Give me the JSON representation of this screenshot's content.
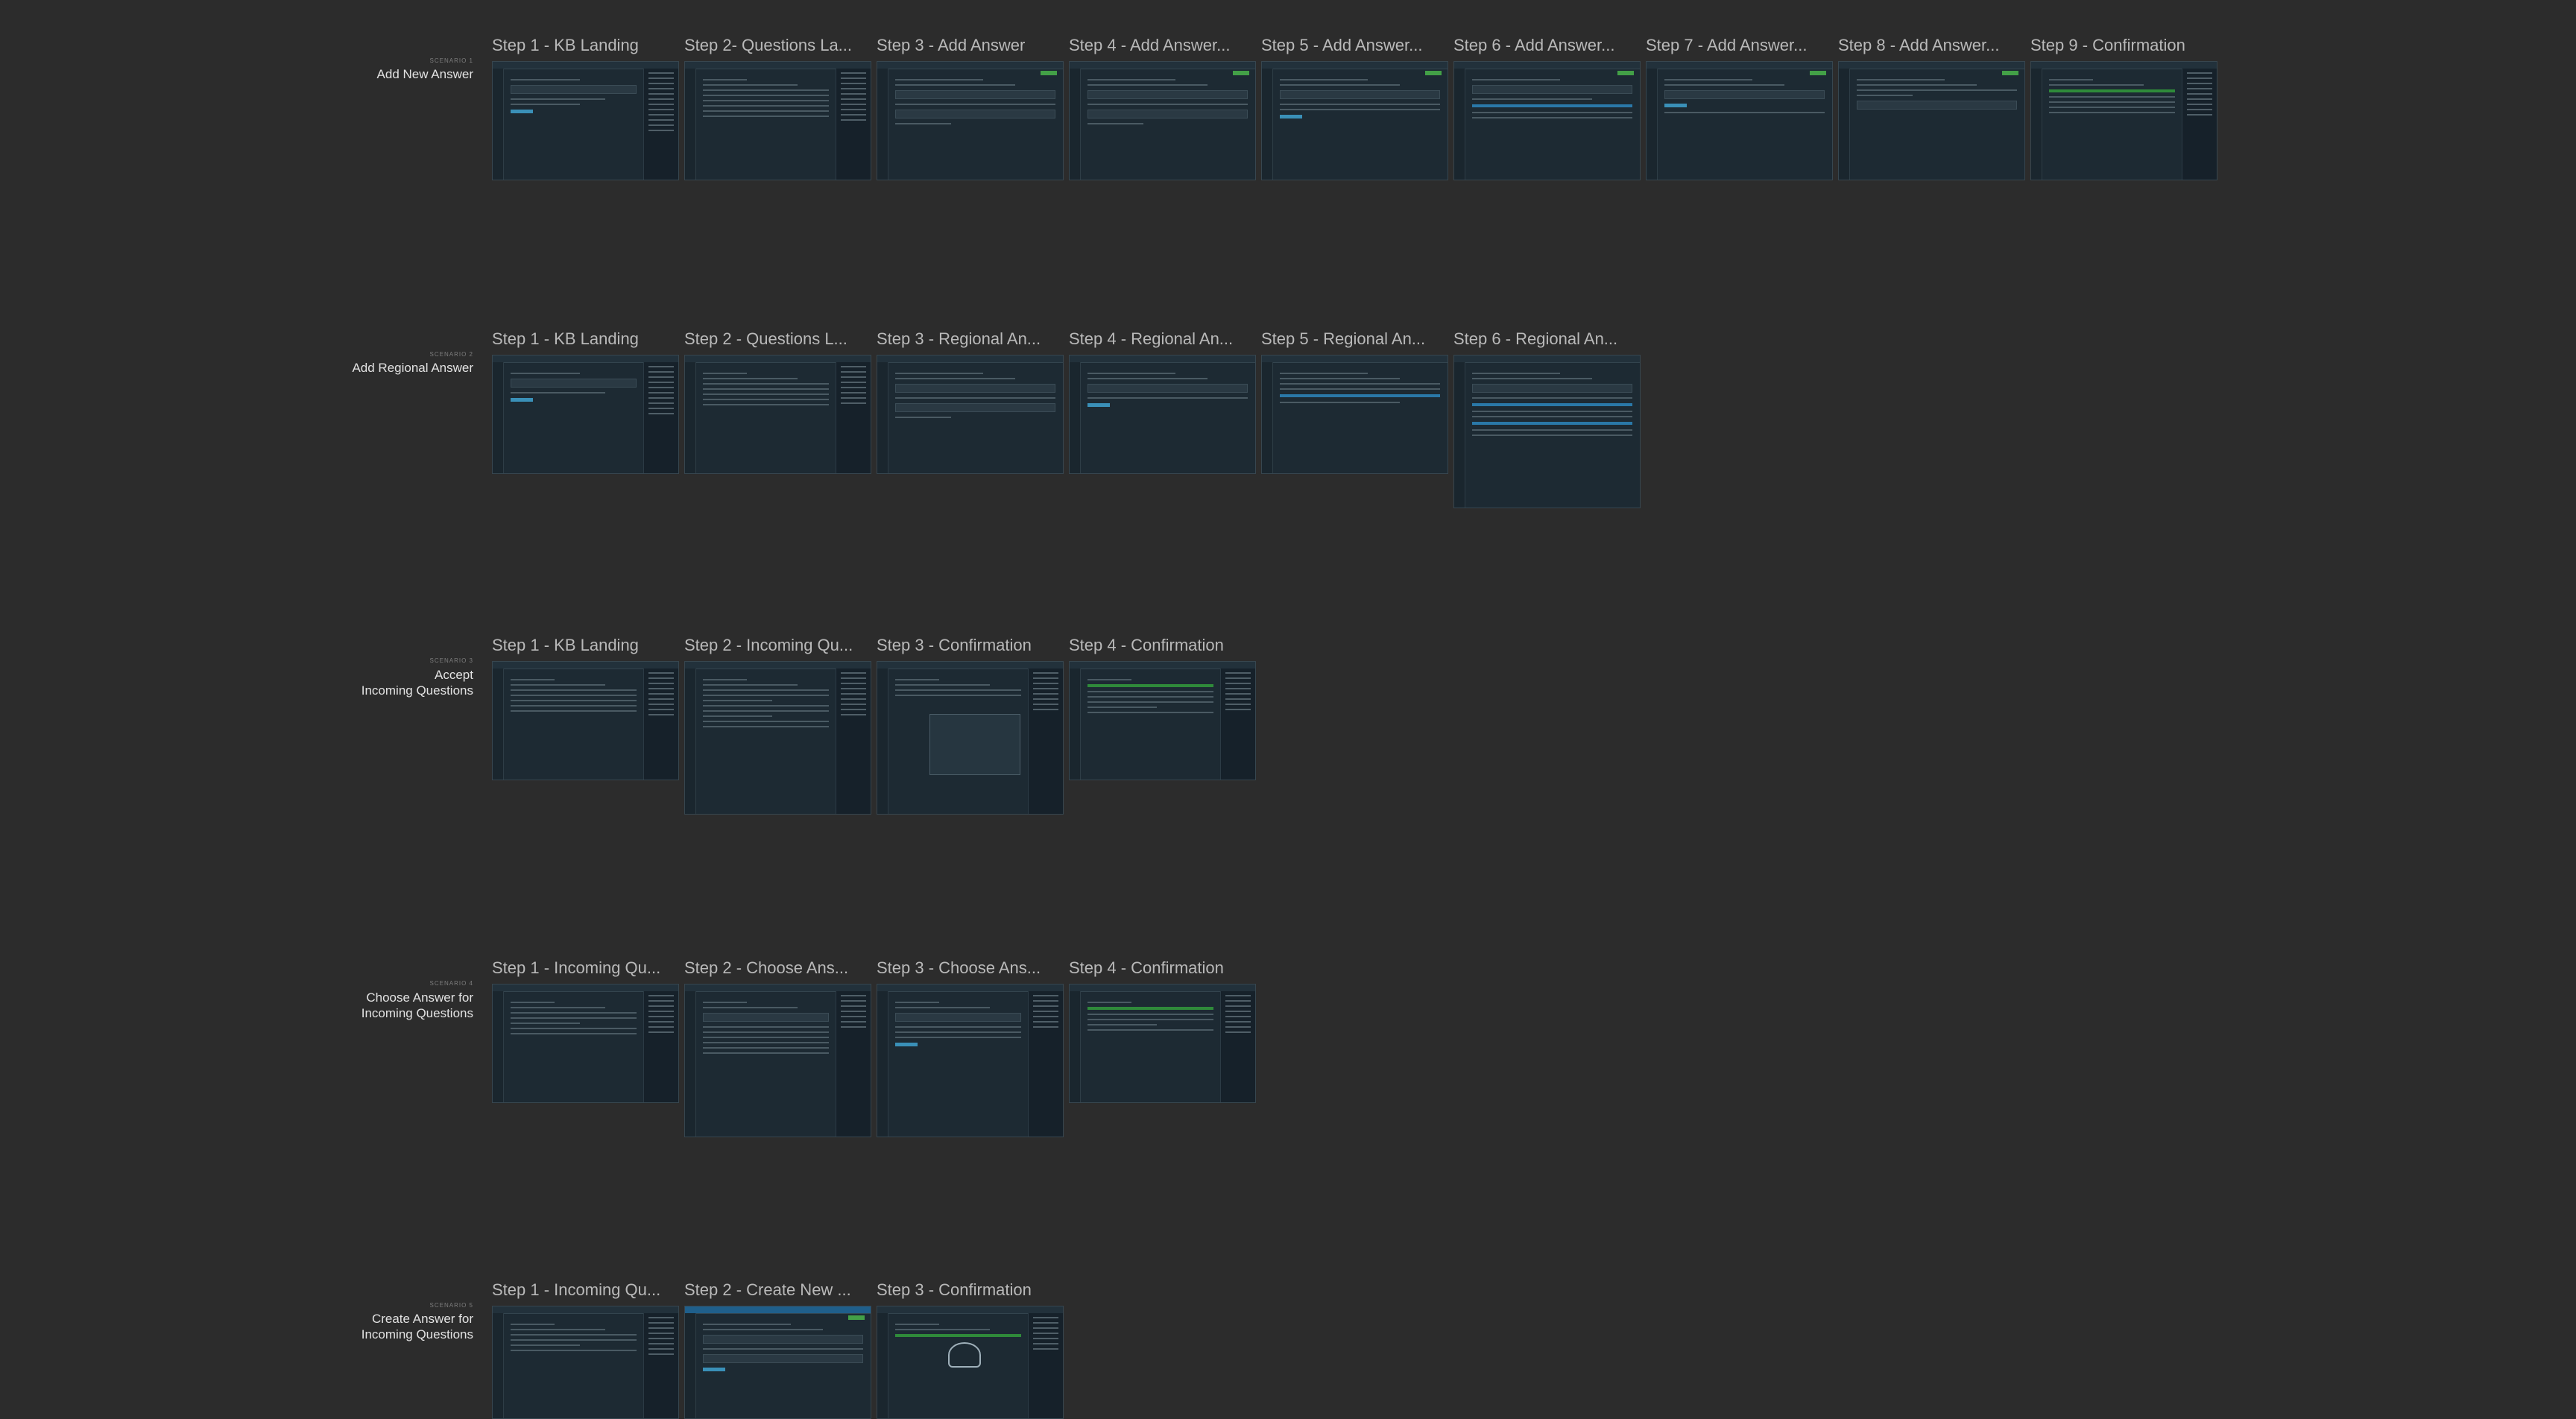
{
  "scenarios": [
    {
      "eyebrow": "SCENARIO 1",
      "title_lines": [
        "Add New Answer"
      ],
      "frames": [
        {
          "title": "Step 1 - KB Landing"
        },
        {
          "title": "Step 2- Questions La..."
        },
        {
          "title": "Step 3 - Add Answer"
        },
        {
          "title": "Step 4 - Add Answer..."
        },
        {
          "title": "Step 5 - Add Answer..."
        },
        {
          "title": "Step 6 - Add Answer..."
        },
        {
          "title": "Step 7 - Add Answer..."
        },
        {
          "title": "Step 8 - Add Answer..."
        },
        {
          "title": "Step 9 - Confirmation"
        }
      ]
    },
    {
      "eyebrow": "SCENARIO 2",
      "title_lines": [
        "Add Regional Answer"
      ],
      "frames": [
        {
          "title": "Step 1 - KB Landing"
        },
        {
          "title": "Step 2 - Questions L..."
        },
        {
          "title": "Step 3 - Regional An..."
        },
        {
          "title": "Step 4 - Regional An..."
        },
        {
          "title": "Step 5 - Regional An..."
        },
        {
          "title": "Step 6 - Regional An..."
        }
      ]
    },
    {
      "eyebrow": "SCENARIO 3",
      "title_lines": [
        "Accept",
        "Incoming Questions"
      ],
      "frames": [
        {
          "title": "Step 1 - KB Landing"
        },
        {
          "title": "Step 2 - Incoming Qu..."
        },
        {
          "title": "Step 3 - Confirmation"
        },
        {
          "title": "Step 4 - Confirmation"
        }
      ]
    },
    {
      "eyebrow": "SCENARIO 4",
      "title_lines": [
        "Choose Answer for",
        "Incoming Questions"
      ],
      "frames": [
        {
          "title": "Step 1 - Incoming Qu..."
        },
        {
          "title": "Step 2 - Choose Ans..."
        },
        {
          "title": "Step 3 - Choose Ans..."
        },
        {
          "title": "Step 4 - Confirmation"
        }
      ]
    },
    {
      "eyebrow": "SCENARIO 5",
      "title_lines": [
        "Create Answer for",
        "Incoming Questions"
      ],
      "frames": [
        {
          "title": "Step 1 - Incoming Qu..."
        },
        {
          "title": "Step 2 - Create New ..."
        },
        {
          "title": "Step 3 - Confirmation"
        }
      ]
    }
  ],
  "colors": {
    "canvas_bg": "#2c2c2c",
    "frame_bg": "#1d2a33",
    "accent_green": "#43a047",
    "accent_blue": "#3a90b8"
  }
}
